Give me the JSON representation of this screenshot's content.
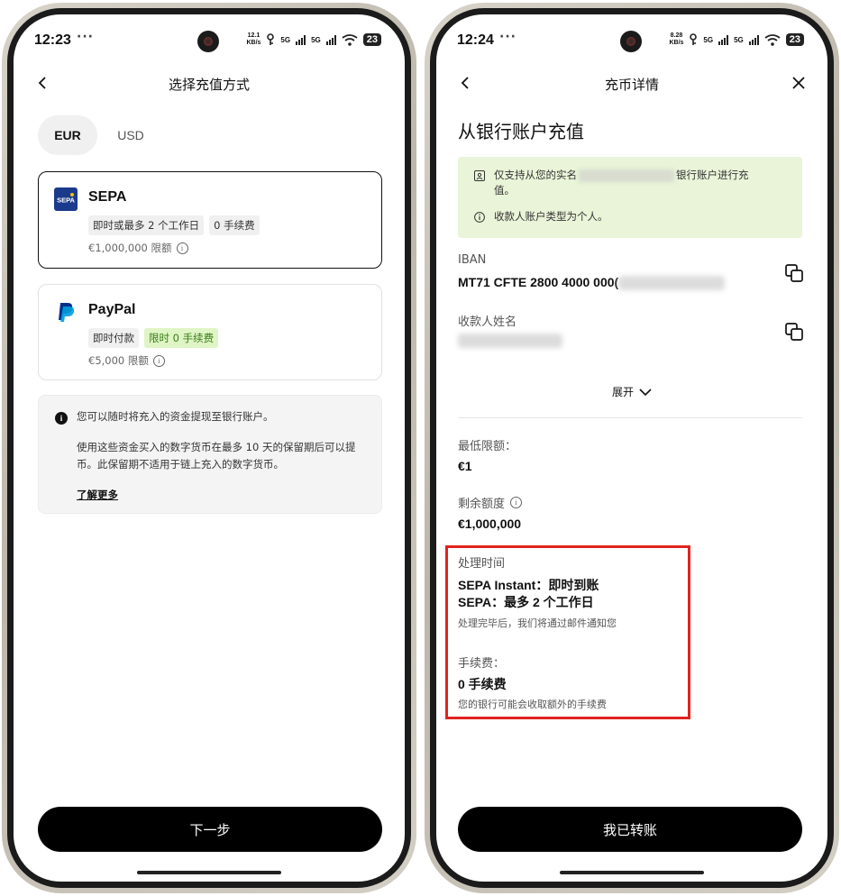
{
  "left": {
    "status": {
      "time": "12:23",
      "more": "···",
      "netspeed_value": "12.1",
      "netspeed_unit": "KB/s",
      "sig1": "5G",
      "sig2": "5G",
      "battery": "23"
    },
    "header": {
      "title": "选择充值方式"
    },
    "currency_tabs": [
      "EUR",
      "USD"
    ],
    "methods": [
      {
        "name": "SEPA",
        "tags": [
          "即时或最多 2 个工作日",
          "0 手续费"
        ],
        "limit": "€1,000,000 限额"
      },
      {
        "name": "PayPal",
        "tags": [
          "即时付款",
          "限时 0 手续费"
        ],
        "limit": "€5,000 限额"
      }
    ],
    "notice": {
      "line1": "您可以随时将充入的资金提现至银行账户。",
      "line2": "使用这些资金买入的数字货币在最多 10 天的保留期后可以提币。此保留期不适用于链上充入的数字货币。",
      "link": "了解更多"
    },
    "cta": "下一步"
  },
  "right": {
    "status": {
      "time": "12:24",
      "more": "···",
      "netspeed_value": "8.28",
      "netspeed_unit": "KB/s",
      "sig1": "5G",
      "sig2": "5G",
      "battery": "23"
    },
    "header": {
      "title": "充币详情"
    },
    "page_title": "从银行账户充值",
    "alert": {
      "line1_pre": "仅支持从您的实名",
      "line1_post": "银行账户进行充值。",
      "line2": "收款人账户类型为个人。"
    },
    "iban": {
      "label": "IBAN",
      "value": "MT71 CFTE 2800 4000 000("
    },
    "payee": {
      "label": "收款人姓名"
    },
    "expand": "展开",
    "min": {
      "label": "最低限额：",
      "value": "€1"
    },
    "remaining": {
      "label": "剩余额度",
      "value": "€1,000,000"
    },
    "processing": {
      "label": "处理时间",
      "instant": "SEPA Instant：即时到账",
      "sepa": "SEPA：最多 2 个工作日",
      "note": "处理完毕后，我们将通过邮件通知您"
    },
    "fee": {
      "label": "手续费：",
      "value": "0 手续费",
      "note": "您的银行可能会收取额外的手续费"
    },
    "cta": "我已转账"
  },
  "colors": {
    "accent": "#000000",
    "alert_bg": "#e9f4d8",
    "promo_tag_bg": "#dff5c5",
    "highlight_border": "#e0231f",
    "sepa_blue": "#1a3b8c",
    "paypal_blue": "#009cde"
  }
}
